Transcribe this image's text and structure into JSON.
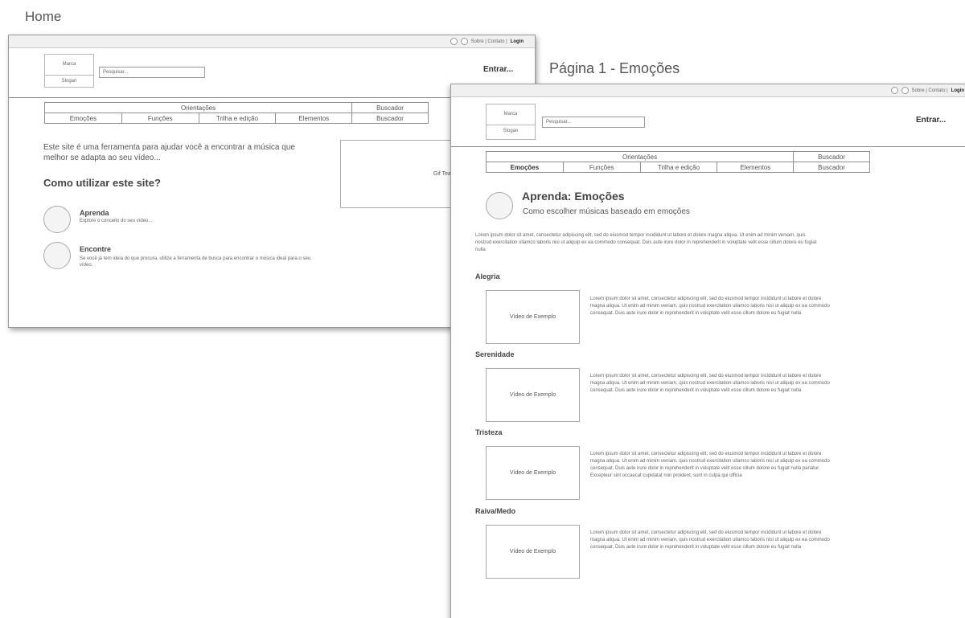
{
  "labels": {
    "home": "Home",
    "page1": "Página 1 - Emoções"
  },
  "home": {
    "topbar": {
      "links": "Sobre | Contato | ",
      "login_link": "Login"
    },
    "brand": {
      "name": "Marca",
      "slogan": "Slogan"
    },
    "search": {
      "placeholder": "Pesquisar..."
    },
    "enter": "Entrar...",
    "nav": {
      "group_orientacoes": "Orientações",
      "group_buscador": "Buscador",
      "items": [
        "Emoções",
        "Funções",
        "Trilha e edição",
        "Elementos",
        "Buscador"
      ]
    },
    "intro": "Este site é uma ferramenta para ajudar você a encontrar a música que melhor se adapta ao seu vídeo...",
    "how_title": "Como utilizar este site?",
    "gif": "Gif Teaser para Buscador",
    "steps": [
      {
        "title": "Aprenda",
        "desc": "Explore o conceito do seu vídeo..."
      },
      {
        "title": "Encontre",
        "desc": "Se você já tem ideia do que procura, utilize a ferramenta de busca para encontrar o música ideal para o seu vídeo."
      }
    ]
  },
  "page1": {
    "topbar": {
      "links": "Sobre | Contato | ",
      "login_link": "Login"
    },
    "brand": {
      "name": "Marca",
      "slogan": "Slogan"
    },
    "search": {
      "placeholder": "Pesquisar..."
    },
    "enter": "Entrar...",
    "nav": {
      "group_orientacoes": "Orientações",
      "group_buscador": "Buscador",
      "items": [
        "Emoções",
        "Funções",
        "Trilha e edição",
        "Elementos",
        "Buscador"
      ],
      "active": "Emoções"
    },
    "heading": "Aprenda: Emoções",
    "subheading": "Como escolher músicas baseado em emoções",
    "intro": "Lorem ipsum dolor sit amet, consectetur adipiscing elit, sed do eiusmod tempor incididunt ut labore et dolore magna aliqua. Ut enim ad minim veniam, quis nostrud exercitation ullamco laboris nisi ut aliquip ex ea commodo consequat. Duis aute irure dolor in reprehenderit in voluptate velit esse cillum dolore eu fugiat nulla",
    "sections": [
      {
        "title": "Alegria",
        "video": "Vídeo de Exemplo",
        "text": "Lorem ipsum dolor sit amet, consectetur adipiscing elit, sed do eiusmod tempor incididunt ut labore et dolore magna aliqua. Ut enim ad minim veniam, quis nostrud exercitation ullamco laboris nisi ut aliquip ex ea commodo consequat. Duis aute irure dolor in reprehenderit in voluptate velit esse cillum dolore eu fugiat nulla"
      },
      {
        "title": "Serenidade",
        "video": "Vídeo de Exemplo",
        "text": "Lorem ipsum dolor sit amet, consectetur adipiscing elit, sed do eiusmod tempor incididunt ut labore et dolore magna aliqua. Ut enim ad minim veniam, quis nostrud exercitation ullamco laboris nisi ut aliquip ex ea commodo consequat. Duis aute irure dolor in reprehenderit in voluptate velit esse cillum dolore eu fugiat nulla"
      },
      {
        "title": "Tristeza",
        "video": "Vídeo de Exemplo",
        "text": "Lorem ipsum dolor sit amet, consectetur adipiscing elit, sed do eiusmod tempor incididunt ut labore et dolore magna aliqua. Ut enim ad minim veniam, quis nostrud exercitation ullamco laboris nisi ut aliquip ex ea commodo consequat. Duis aute irure dolor in reprehenderit in voluptate velit esse cillum dolore eu fugiat nulla pariatur. Excepteur sint occaecat cupidatat non proident, sunt in culpa qui officia"
      },
      {
        "title": "Raiva/Medo",
        "video": "Vídeo de Exemplo",
        "text": "Lorem ipsum dolor sit amet, consectetur adipiscing elit, sed do eiusmod tempor incididunt ut labore et dolore magna aliqua. Ut enim ad minim veniam, quis nostrud exercitation ullamco laboris nisi ut aliquip ex ea commodo consequat. Duis aute irure dolor in reprehenderit in voluptate velit esse cillum dolore eu fugiat nulla"
      }
    ]
  }
}
